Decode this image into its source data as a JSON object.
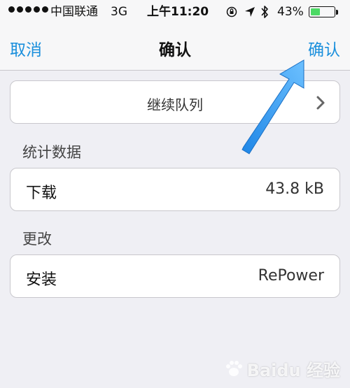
{
  "status_bar": {
    "carrier": "中国联通",
    "network": "3G",
    "time": "上午11:20",
    "battery_percent": "43%",
    "battery_level": 0.43,
    "battery_color": "#4cd964",
    "icons": [
      "signal-dots",
      "rotation-lock-icon",
      "location-icon",
      "bluetooth-icon",
      "battery-icon"
    ]
  },
  "nav": {
    "left": "取消",
    "title": "确认",
    "right": "确认",
    "accent_color": "#1a8fdc"
  },
  "queue": {
    "label": "继续队列",
    "icon": "chevron-right-icon"
  },
  "sections": [
    {
      "header": "统计数据",
      "row": {
        "key": "下载",
        "value": "43.8 kB"
      }
    },
    {
      "header": "更改",
      "row": {
        "key": "安装",
        "value": "RePower"
      }
    }
  ],
  "annotation": {
    "icon": "arrow-annotation",
    "color": "#2f8fe8"
  },
  "watermark": {
    "text": "Baidu 经验"
  }
}
